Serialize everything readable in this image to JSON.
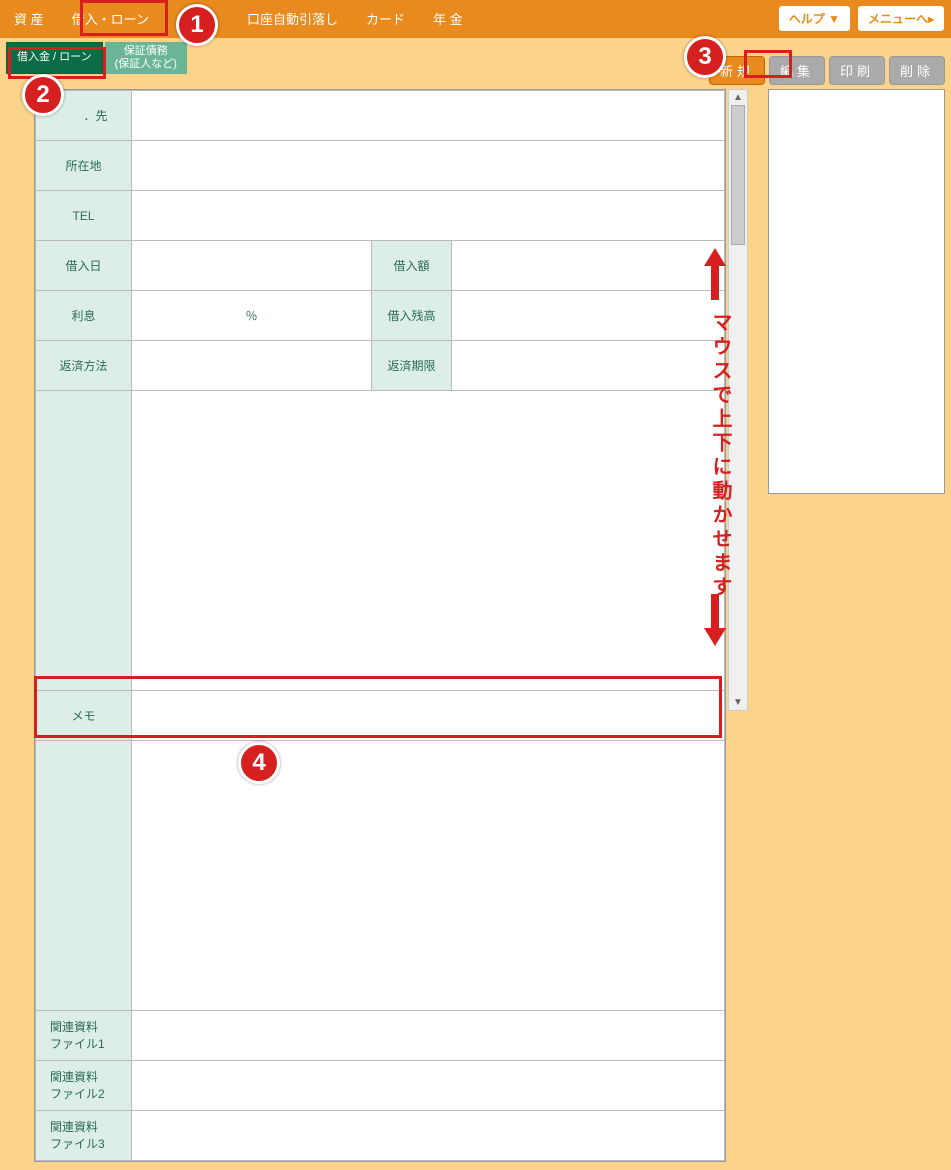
{
  "nav": {
    "items": [
      "資 産",
      "借入・ローン",
      "口座自動引落し",
      "カード",
      "年 金"
    ],
    "help": "ヘルプ ▼",
    "menu": "メニューへ▸"
  },
  "subtabs": {
    "active": "借入金 / ローン",
    "guarantee_line1": "保証債務",
    "guarantee_line2": "(保証人など)"
  },
  "actions": {
    "new": "新規",
    "edit": "編集",
    "print": "印刷",
    "delete": "削除"
  },
  "form": {
    "lender_partial": "．先",
    "address": "所在地",
    "tel": "TEL",
    "borrow_date": "借入日",
    "borrow_amount": "借入額",
    "interest": "利息",
    "percent": "％",
    "balance": "借入残高",
    "repay_method": "返済方法",
    "repay_due": "返済期限",
    "memo": "メモ",
    "file1a": "関連資料",
    "file1b": "ファイル1",
    "file2a": "関連資料",
    "file2b": "ファイル2",
    "file3a": "関連資料",
    "file3b": "ファイル3"
  },
  "annotations": {
    "n1": "1",
    "n2": "2",
    "n3": "3",
    "n4": "4",
    "scroll_hint": "マウスで上下に動かせます"
  }
}
